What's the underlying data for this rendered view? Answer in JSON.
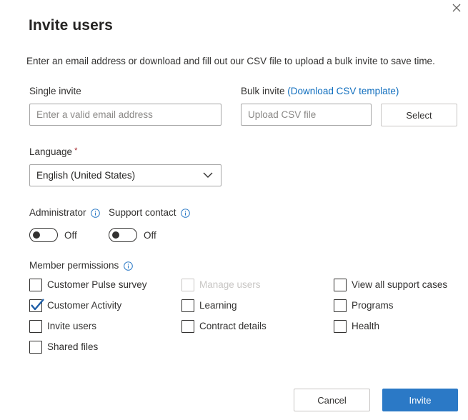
{
  "dialog": {
    "title": "Invite users",
    "description": "Enter an email address or download and fill out our CSV file to upload a bulk invite to save time."
  },
  "single_invite": {
    "label": "Single invite",
    "placeholder": "Enter a valid email address",
    "value": ""
  },
  "bulk_invite": {
    "label": "Bulk invite",
    "link_text": "(Download CSV template)",
    "placeholder": "Upload CSV file",
    "select_label": "Select"
  },
  "language": {
    "label": "Language",
    "required_marker": "*",
    "selected": "English (United States)"
  },
  "toggles": {
    "administrator": {
      "label": "Administrator",
      "state": "Off",
      "on": false
    },
    "support_contact": {
      "label": "Support contact",
      "state": "Off",
      "on": false
    }
  },
  "permissions": {
    "label": "Member permissions",
    "items": [
      {
        "label": "Customer Pulse survey",
        "checked": false,
        "disabled": false
      },
      {
        "label": "Customer Activity",
        "checked": true,
        "disabled": false
      },
      {
        "label": "Invite users",
        "checked": false,
        "disabled": false
      },
      {
        "label": "Shared files",
        "checked": false,
        "disabled": false
      },
      {
        "label": "Manage users",
        "checked": false,
        "disabled": true
      },
      {
        "label": "Learning",
        "checked": false,
        "disabled": false
      },
      {
        "label": "Contract details",
        "checked": false,
        "disabled": false
      },
      {
        "label": "View all support cases",
        "checked": false,
        "disabled": false
      },
      {
        "label": "Programs",
        "checked": false,
        "disabled": false
      },
      {
        "label": "Health",
        "checked": false,
        "disabled": false
      }
    ]
  },
  "footer": {
    "cancel_label": "Cancel",
    "invite_label": "Invite"
  },
  "icons": {
    "close": "close-icon",
    "info": "info-icon",
    "chevron": "chevron-down-icon",
    "check": "checkmark-icon"
  },
  "colors": {
    "accent": "#2b79c6",
    "link": "#106ebe",
    "required": "#a4262c",
    "check": "#1f5fa8"
  }
}
